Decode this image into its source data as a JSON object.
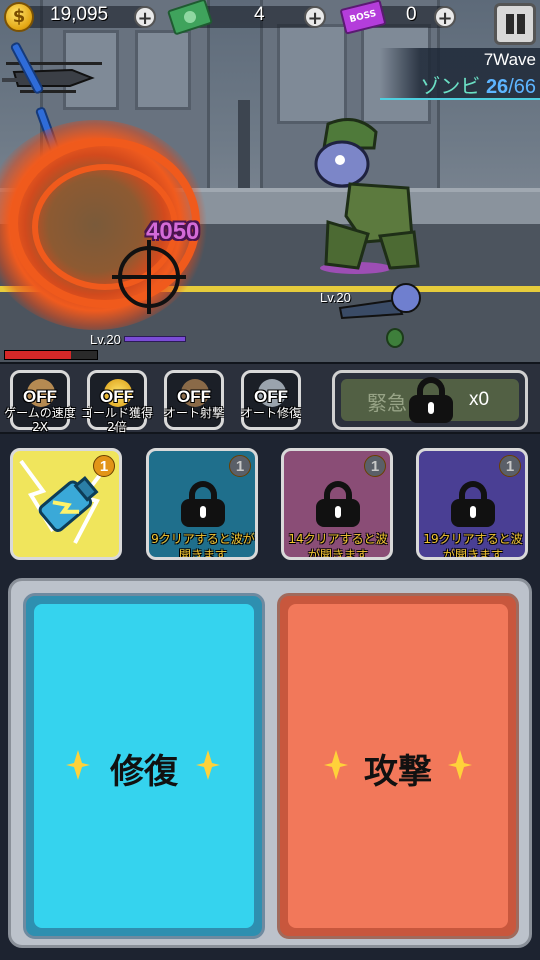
{
  "hud": {
    "coins": "19,095",
    "cash": "4",
    "boss_tickets": "0",
    "ticket_label": "BOSS",
    "coin_symbol": "$",
    "plus_symbol": "+"
  },
  "wave": {
    "label": "7Wave",
    "zombie_label": "ゾンビ",
    "zombies_current": "26",
    "zombies_separator": "/",
    "zombies_total": "66"
  },
  "battle": {
    "damage_number": "4050",
    "player_level": "Lv.20",
    "zombie_level": "Lv.20",
    "player_hp_fraction": 0.72
  },
  "toggles": [
    {
      "state": "OFF",
      "label": "ゲームの速度 2X",
      "icon": "zombie-speed-icon"
    },
    {
      "state": "OFF",
      "label": "ゴールド獲得2倍",
      "icon": "gold-coin-icon"
    },
    {
      "state": "OFF",
      "label": "オート射撃",
      "icon": "soldier-icon"
    },
    {
      "state": "OFF",
      "label": "オート修復",
      "icon": "wrench-icon"
    }
  ],
  "emergency": {
    "label": "緊急",
    "count": "x0",
    "locked": true
  },
  "skills": [
    {
      "badge": "1",
      "locked": false,
      "icon": "lightning-grenade-icon",
      "unlock_text": ""
    },
    {
      "badge": "1",
      "locked": true,
      "icon": "locked-skill-icon",
      "unlock_text": "9クリアすると波が開きます"
    },
    {
      "badge": "1",
      "locked": true,
      "icon": "locked-skill-icon",
      "unlock_text": "14クリアすると波が開きます"
    },
    {
      "badge": "1",
      "locked": true,
      "icon": "locked-skill-icon",
      "unlock_text": "19クリアすると波が開きます"
    }
  ],
  "actions": {
    "repair_label": "修復",
    "attack_label": "攻撃"
  },
  "colors": {
    "repair_card": "#35d3ee",
    "attack_card": "#f2785a",
    "accent_blue": "#5db5ff",
    "spark": "#ffd23a"
  }
}
